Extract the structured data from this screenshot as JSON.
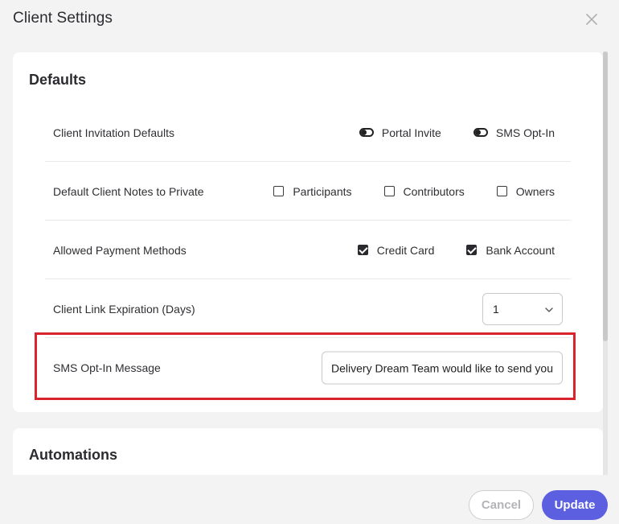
{
  "header": {
    "title": "Client Settings"
  },
  "defaults": {
    "title": "Defaults",
    "rows": [
      {
        "label": "Client Invitation Defaults",
        "toggles": [
          {
            "label": "Portal Invite",
            "on": false
          },
          {
            "label": "SMS Opt-In",
            "on": false
          }
        ]
      },
      {
        "label": "Default Client Notes to Private",
        "checkboxes": [
          {
            "label": "Participants",
            "checked": false
          },
          {
            "label": "Contributors",
            "checked": false
          },
          {
            "label": "Owners",
            "checked": false
          }
        ]
      },
      {
        "label": "Allowed Payment Methods",
        "checkboxes": [
          {
            "label": "Credit Card",
            "checked": true
          },
          {
            "label": "Bank Account",
            "checked": true
          }
        ]
      },
      {
        "label": "Client Link Expiration (Days)",
        "select_value": "1"
      },
      {
        "label": "SMS Opt-In Message",
        "input_value": "Delivery Dream Team would like to send you"
      }
    ]
  },
  "automations": {
    "title": "Automations"
  },
  "footer": {
    "cancel_label": "Cancel",
    "update_label": "Update"
  },
  "colors": {
    "accent": "#5b5fe0",
    "highlight": "#d9232d"
  }
}
